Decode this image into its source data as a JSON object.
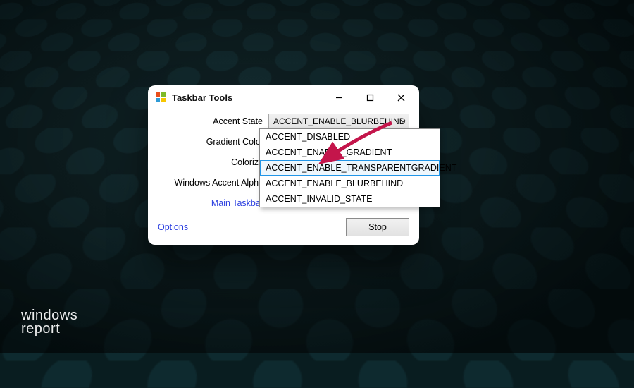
{
  "window": {
    "title": "Taskbar Tools"
  },
  "form": {
    "accent_state_label": "Accent State",
    "gradient_color_label": "Gradient Color",
    "colorize_label": "Colorize",
    "windows_accent_alpha_label": "Windows Accent Alpha",
    "main_taskbar_label": "Main Taskbar",
    "options_label": "Options",
    "stop_label": "Stop"
  },
  "accent_state": {
    "selected": "ACCENT_ENABLE_BLURBEHIND",
    "options": [
      "ACCENT_DISABLED",
      "ACCENT_ENABLE_GRADIENT",
      "ACCENT_ENABLE_TRANSPARENTGRADIENT",
      "ACCENT_ENABLE_BLURBEHIND",
      "ACCENT_INVALID_STATE"
    ],
    "highlighted_index": 2
  },
  "watermark": {
    "line1": "windows",
    "line2": "report"
  },
  "colors": {
    "link": "#2a3ee0",
    "arrow": "#c4154b"
  }
}
